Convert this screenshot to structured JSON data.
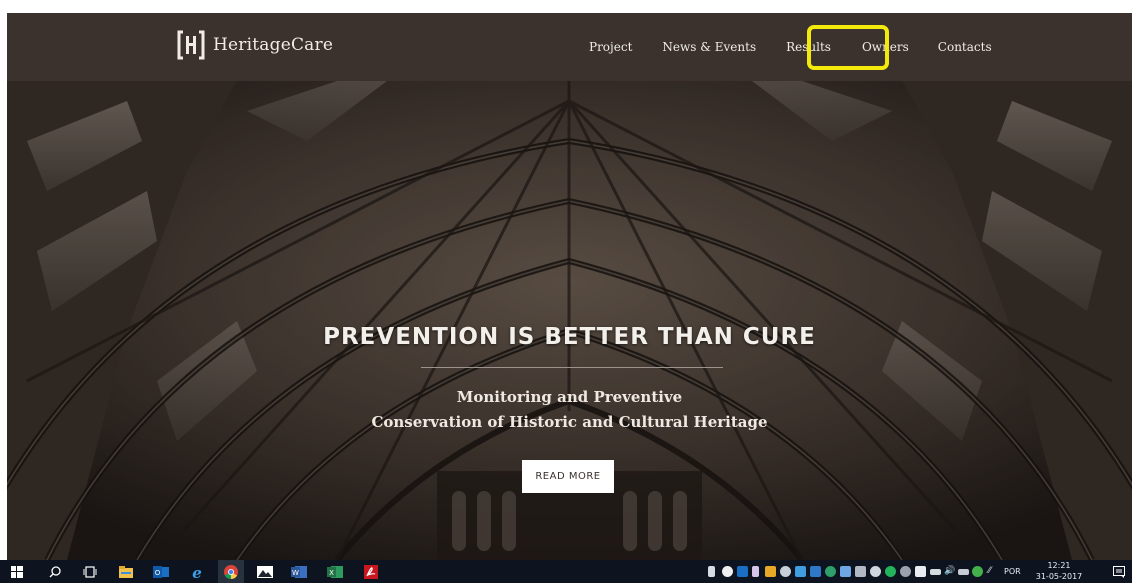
{
  "site": {
    "logo_text": "HeritageCare",
    "nav": [
      "Project",
      "News & Events",
      "Results",
      "Owners",
      "Contacts"
    ],
    "highlighted_nav": "Owners"
  },
  "hero": {
    "headline": "PREVENTION IS BETTER THAN CURE",
    "subtitle_line1": "Monitoring and Preventive",
    "subtitle_line2": "Conservation of Historic and Cultural Heritage",
    "button_label": "READ MORE"
  },
  "taskbar": {
    "pinned_apps": [
      "windows-start-icon",
      "search-icon",
      "task-view-icon",
      "file-explorer-icon",
      "outlook-icon",
      "internet-explorer-icon",
      "chrome-icon",
      "photos-icon",
      "word-icon",
      "excel-icon",
      "acrobat-icon"
    ],
    "language": "POR",
    "time": "12:21",
    "date": "31-05-2017"
  },
  "colors": {
    "nav_bg": "#3b322d",
    "highlight": "#f3ea0b",
    "hero_dark": "#2a231f",
    "taskbar_bg": "#0d1420"
  }
}
